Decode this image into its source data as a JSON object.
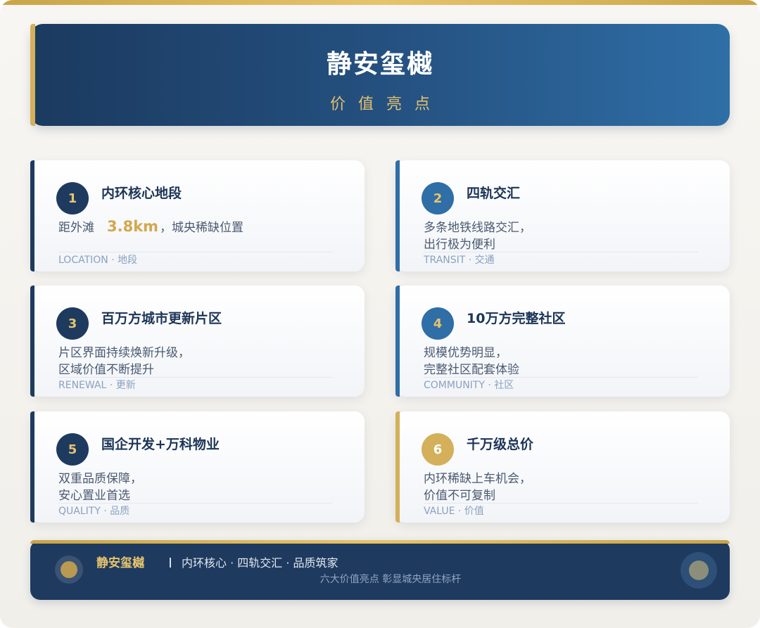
{
  "header": {
    "title": "静安玺樾",
    "subtitle": "价值亮点"
  },
  "colors": {
    "navy": "#1e3a5f",
    "blue": "#2f6ea6",
    "gold": "#d4b05a"
  },
  "cards": [
    {
      "number": "1",
      "title": "内环核心地段",
      "desc_prefix": "距外滩",
      "desc_highlight": "3.8km",
      "desc_suffix": "，城央稀缺位置",
      "tag": "LOCATION · 地段",
      "accent": "#1e3a5f"
    },
    {
      "number": "2",
      "title": "四轨交汇",
      "desc_line1": "多条地铁线路交汇，",
      "desc_line2": "出行极为便利",
      "tag": "TRANSIT · 交通",
      "accent": "#2f6ea6"
    },
    {
      "number": "3",
      "title": "百万方城市更新片区",
      "desc_line1": "片区界面持续焕新升级，",
      "desc_line2": "区域价值不断提升",
      "tag": "RENEWAL · 更新",
      "accent": "#1e3a5f"
    },
    {
      "number": "4",
      "title": "10万方完整社区",
      "desc_line1": "规模优势明显，",
      "desc_line2": "完整社区配套体验",
      "tag": "COMMUNITY · 社区",
      "accent": "#2f6ea6"
    },
    {
      "number": "5",
      "title": "国企开发+万科物业",
      "desc_line1": "双重品质保障，",
      "desc_line2": "安心置业首选",
      "tag": "QUALITY · 品质",
      "accent": "#1e3a5f"
    },
    {
      "number": "6",
      "title": "千万级总价",
      "desc_line1": "内环稀缺上车机会，",
      "desc_line2": "价值不可复制",
      "tag": "VALUE · 价值",
      "accent": "#d4b05a"
    }
  ],
  "footer": {
    "brand": "静安玺樾",
    "slogan": "内环核心 · 四轨交汇 · 品质筑家",
    "sub": "六大价值亮点 彰显城央居住标杆"
  }
}
